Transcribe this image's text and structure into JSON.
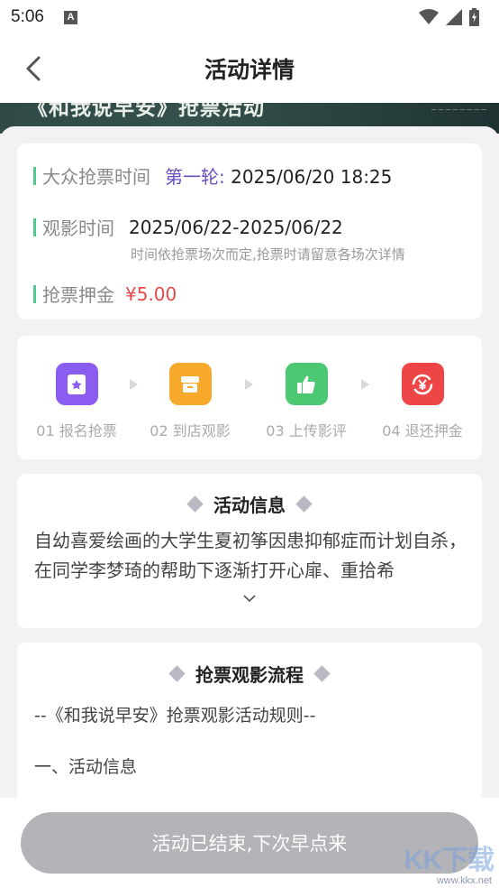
{
  "status_bar": {
    "time": "5:06",
    "notification_badge": "A"
  },
  "navbar": {
    "title": "活动详情"
  },
  "banner": {
    "title": "《和我说早安》抢票活动"
  },
  "info": {
    "grab_label": "大众抢票时间",
    "round_label": "第一轮:",
    "grab_time": "2025/06/20 18:25",
    "watch_label": "观影时间",
    "watch_time": "2025/06/22-2025/06/22",
    "note": "时间依抢票场次而定,抢票时请留意各场次详情",
    "deposit_label": "抢票押金",
    "deposit_value": "¥5.00"
  },
  "steps": [
    {
      "label": "01 报名抢票",
      "icon": "bookmark-star-icon",
      "color": "#8a5cf0"
    },
    {
      "label": "02 到店观影",
      "icon": "store-icon",
      "color": "#f7a92b"
    },
    {
      "label": "03 上传影评",
      "icon": "thumbs-up-icon",
      "color": "#4cc872"
    },
    {
      "label": "04 退还押金",
      "icon": "yuan-refund-icon",
      "color": "#ee4646"
    }
  ],
  "description": {
    "title": "活动信息",
    "text": "自幼喜爱绘画的大学生夏初筝因患抑郁症而计划自杀，在同学李梦琦的帮助下逐渐打开心扉、重拾希"
  },
  "flow": {
    "title": "抢票观影流程",
    "subtitle": "--《和我说早安》抢票观影活动规则--",
    "item1": "一、活动信息"
  },
  "bottom": {
    "button_label": "活动已结束,下次早点来"
  },
  "watermark": {
    "text": "KK下载",
    "url": "www.kkx.net"
  }
}
